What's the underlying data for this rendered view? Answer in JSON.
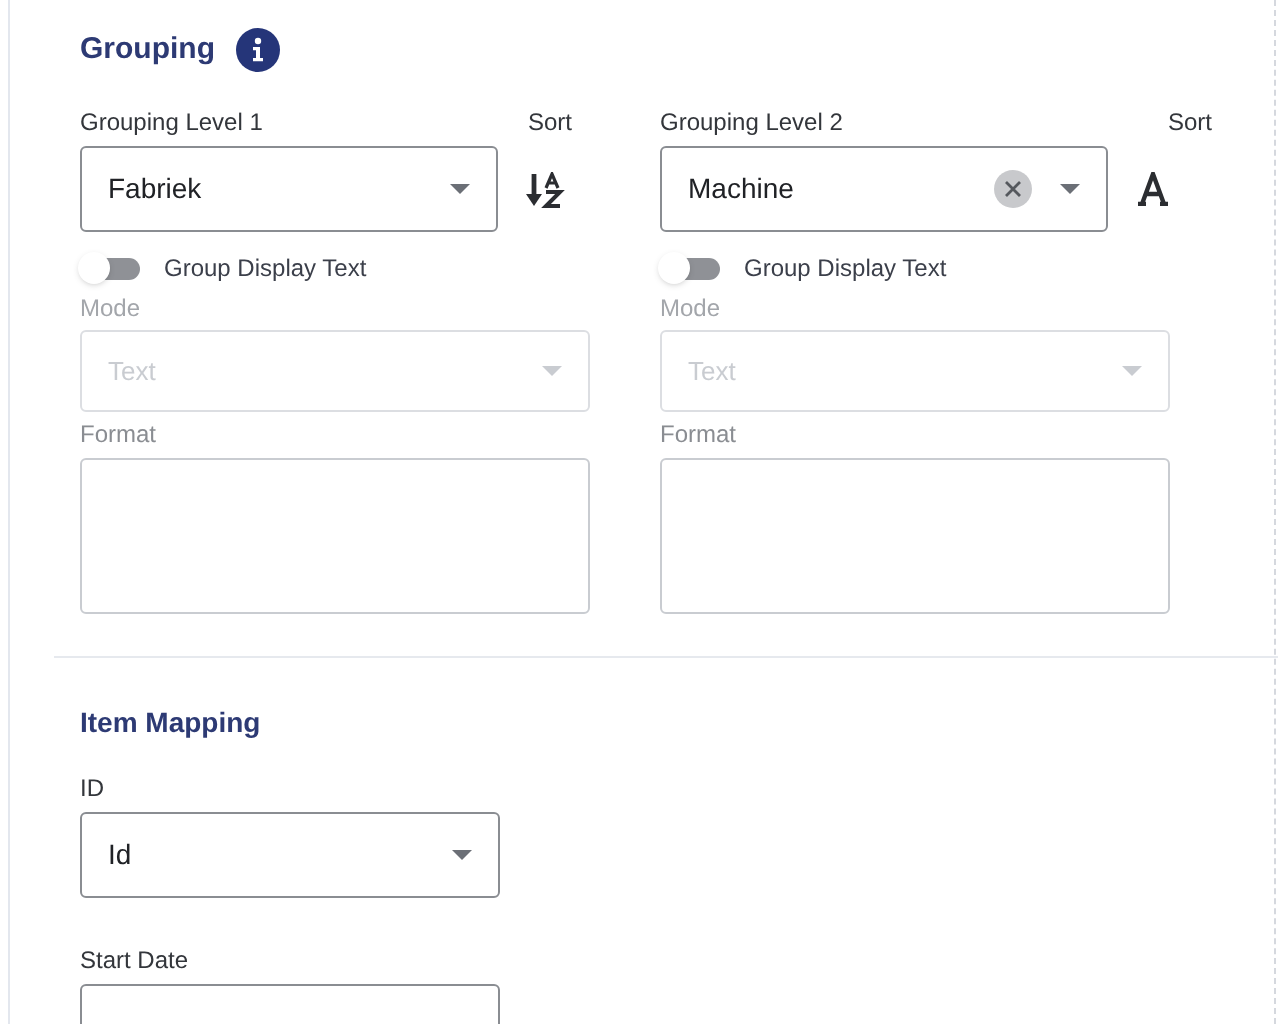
{
  "grouping": {
    "title": "Grouping",
    "levels": [
      {
        "label": "Grouping Level 1",
        "sort": {
          "label": "Sort",
          "kind": "az"
        },
        "value": "Fabriek",
        "clearable": false,
        "display_text": {
          "label": "Group Display Text",
          "on": false
        },
        "mode": {
          "label": "Mode",
          "placeholder": "Text",
          "disabled": true
        },
        "format": {
          "label": "Format"
        }
      },
      {
        "label": "Grouping Level 2",
        "sort": {
          "label": "Sort",
          "kind": "letter"
        },
        "value": "Machine",
        "clearable": true,
        "display_text": {
          "label": "Group Display Text",
          "on": false
        },
        "mode": {
          "label": "Mode",
          "placeholder": "Text",
          "disabled": true
        },
        "format": {
          "label": "Format"
        }
      }
    ]
  },
  "item_mapping": {
    "title": "Item Mapping",
    "fields": [
      {
        "label": "ID",
        "value": "Id"
      },
      {
        "label": "Start Date"
      }
    ]
  }
}
